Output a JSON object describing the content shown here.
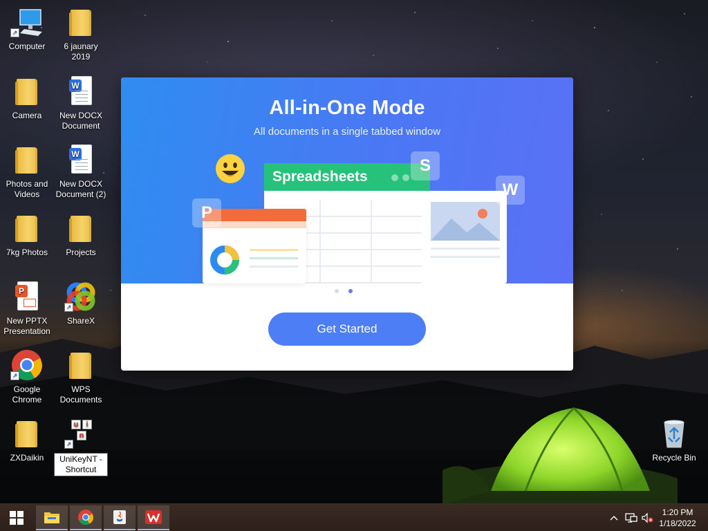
{
  "desktop": {
    "icons": {
      "computer": "Computer",
      "jan2019_line1": "6 jaunary",
      "jan2019_line2": "2019",
      "camera": "Camera",
      "docx1_line1": "New DOCX",
      "docx1_line2": "Document",
      "photos_line1": "Photos and",
      "photos_line2": "Videos",
      "docx2_line1": "New DOCX",
      "docx2_line2": "Document (2)",
      "photos7kg": "7kg Photos",
      "projects": "Projects",
      "pptx_line1": "New PPTX",
      "pptx_line2": "Presentation",
      "sharex": "ShareX",
      "chrome_line1": "Google",
      "chrome_line2": "Chrome",
      "wps_line1": "WPS",
      "wps_line2": "Documents",
      "zxdaikin": "ZXDaikin",
      "unikey_line1": "UniKeyNT -",
      "unikey_line2": "Shortcut",
      "recycle": "Recycle Bin"
    }
  },
  "dialog": {
    "title": "All-in-One Mode",
    "subtitle": "All documents in a single tabbed window",
    "illustration_label": "Spreadsheets",
    "badges": {
      "s": "S",
      "p": "P",
      "w": "W"
    },
    "pages": 2,
    "active_page": 2,
    "button_label": "Get Started",
    "accent": "#4d7ef6"
  },
  "unikey_letters": {
    "u": "u",
    "i": "i",
    "n": "n"
  },
  "doc_badges": {
    "word": "W",
    "ppt": "P"
  },
  "taskbar": {
    "apps": [
      "file-explorer",
      "google-chrome",
      "java",
      "wps-office"
    ],
    "time": "1:20 PM",
    "date": "1/18/2022"
  }
}
